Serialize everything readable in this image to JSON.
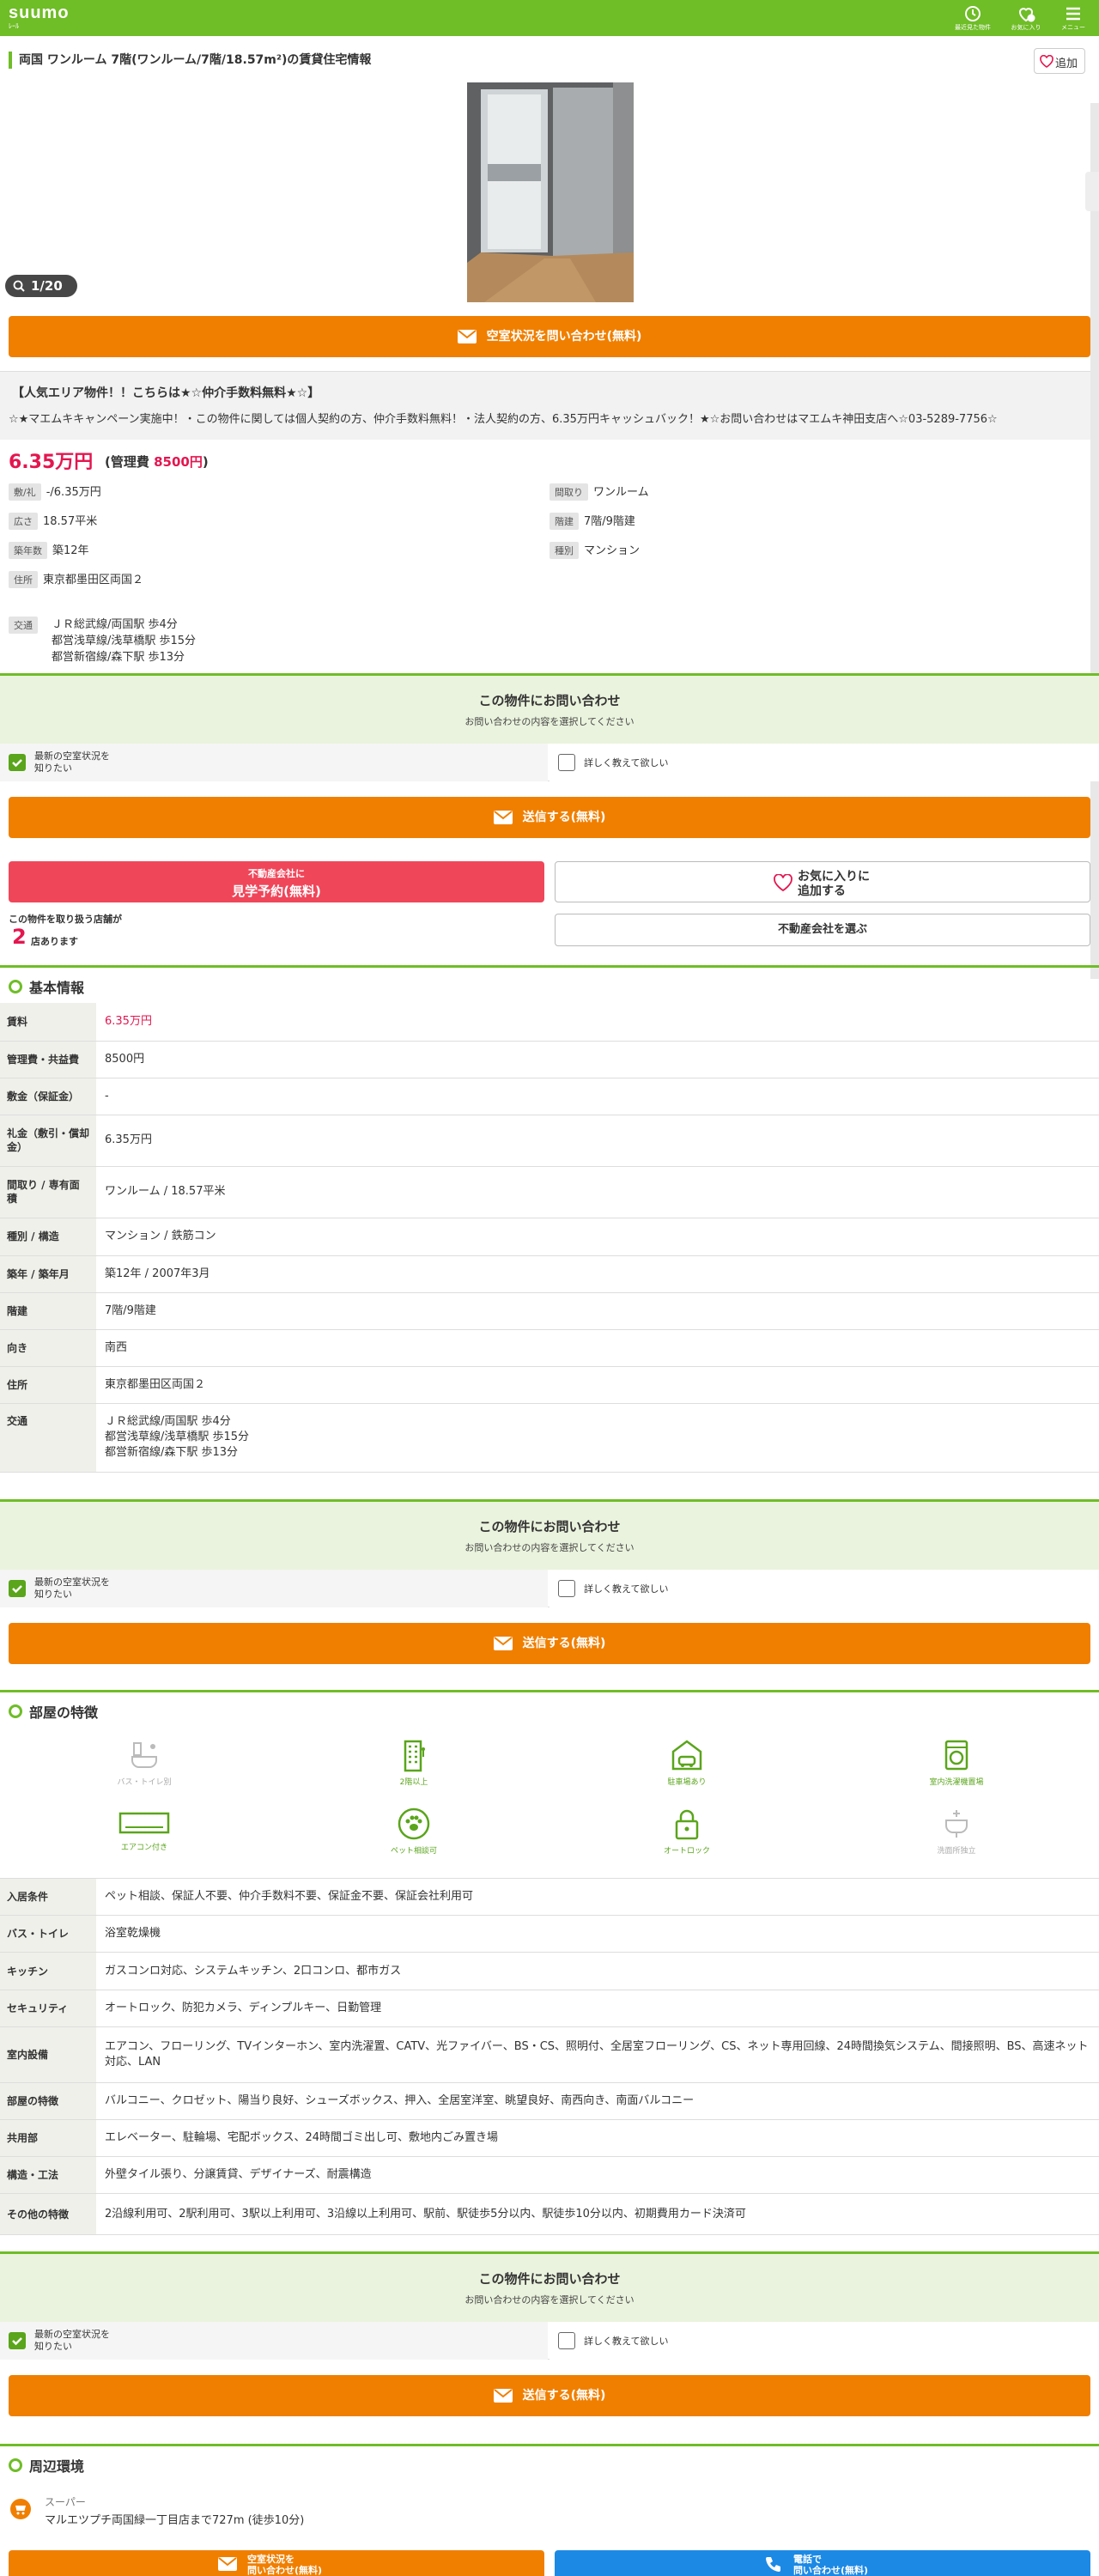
{
  "header": {
    "logo": "suumo",
    "logo_sub": "ﾚｰﾙ",
    "history_label": "最近見た物件",
    "favorites_label": "お気に入り",
    "favorites_count": "0",
    "menu_label": "メニュー"
  },
  "property": {
    "title": "両国 ワンルーム 7階(ワンルーム/7階/18.57m²)の賃貸住宅情報",
    "add_favorite": "追加",
    "photo_counter": "1/20",
    "inquiry_vacancy_button": "空室状況を問い合わせ(無料)",
    "pr_title": "【人気エリア物件！！こちらは★☆仲介手数料無料★☆】",
    "pr_body": "☆★マエムキキャンペーン実施中！・この物件に関しては個人契約の方、仲介手数料無料！・法人契約の方、6.35万円キャッシュバック！★☆お問い合わせはマエムキ神田支店へ☆03-5289-7756☆",
    "rent": "6.35万円",
    "management_label": "(管理費 ",
    "management_value": "8500円",
    "management_close": ")",
    "specs": {
      "deposit_tag": "敷/礼",
      "deposit_value": "-/6.35万円",
      "area_tag": "広さ",
      "area_value": "18.57平米",
      "age_tag": "築年数",
      "age_value": "築12年",
      "address_tag": "住所",
      "address_value": "東京都墨田区両国２",
      "layout_tag": "間取り",
      "layout_value": "ワンルーム",
      "floor_tag": "階建",
      "floor_value": "7階/9階建",
      "type_tag": "種別",
      "type_value": "マンション",
      "access_tag": "交通",
      "access_lines": [
        "ＪＲ総武線/両国駅 歩4分",
        "都営浅草線/浅草橋駅 歩15分",
        "都営新宿線/森下駅 歩13分"
      ]
    }
  },
  "inquiry": {
    "title": "この物件にお問い合わせ",
    "subtitle": "お問い合わせの内容を選択してください",
    "option_a_line1": "最新の空室状況を",
    "option_a_line2": "知りたい",
    "option_b": "詳しく教えて欲しい",
    "send_button": "送信する(無料)"
  },
  "actions": {
    "visit_small": "不動産会社に",
    "visit_large": "見学予約(無料)",
    "favorite_line1": "お気に入りに",
    "favorite_line2": "追加する",
    "shops_text": "この物件を取り扱う店舗が",
    "shops_count": "2",
    "shops_suffix": "店あります",
    "select_agent": "不動産会社を選ぶ"
  },
  "basic_info": {
    "title": "基本情報",
    "rows": [
      {
        "label": "賃料",
        "value": "6.35万円"
      },
      {
        "label": "管理費・共益費",
        "value": "8500円"
      },
      {
        "label": "敷金（保証金）",
        "value": "-"
      },
      {
        "label": "礼金（敷引・償却金）",
        "value": "6.35万円"
      },
      {
        "label": "間取り / 専有面積",
        "value": "ワンルーム / 18.57平米"
      },
      {
        "label": "種別 / 構造",
        "value": "マンション / 鉄筋コン"
      },
      {
        "label": "築年 / 築年月",
        "value": "築12年 / 2007年3月"
      },
      {
        "label": "階建",
        "value": "7階/9階建"
      },
      {
        "label": "向き",
        "value": "南西"
      },
      {
        "label": "住所",
        "value": "東京都墨田区両国２"
      },
      {
        "label": "交通",
        "lines": [
          "ＪＲ総武線/両国駅 歩4分",
          "都営浅草線/浅草橋駅 歩15分",
          "都営新宿線/森下駅 歩13分"
        ]
      }
    ]
  },
  "features": {
    "title": "部屋の特徴",
    "icons": [
      {
        "label": "バス・トイレ別",
        "active": false,
        "icon": "bath-toilet-icon"
      },
      {
        "label": "2階以上",
        "active": true,
        "icon": "building-icon"
      },
      {
        "label": "駐車場あり",
        "active": true,
        "icon": "parking-icon"
      },
      {
        "label": "室内洗濯機置場",
        "active": true,
        "icon": "washer-icon"
      },
      {
        "label": "エアコン付き",
        "active": true,
        "icon": "aircon-icon"
      },
      {
        "label": "ペット相談可",
        "active": true,
        "icon": "pet-icon"
      },
      {
        "label": "オートロック",
        "active": true,
        "icon": "lock-icon"
      },
      {
        "label": "洗面所独立",
        "active": false,
        "icon": "sink-icon"
      }
    ],
    "rows": [
      {
        "label": "入居条件",
        "value": "ペット相談、保証人不要、仲介手数料不要、保証金不要、保証会社利用可"
      },
      {
        "label": "バス・トイレ",
        "value": "浴室乾燥機"
      },
      {
        "label": "キッチン",
        "value": "ガスコンロ対応、システムキッチン、2口コンロ、都市ガス"
      },
      {
        "label": "セキュリティ",
        "value": "オートロック、防犯カメラ、ディンプルキー、日勤管理"
      },
      {
        "label": "室内設備",
        "value": "エアコン、フローリング、TVインターホン、室内洗濯置、CATV、光ファイバー、BS・CS、照明付、全居室フローリング、CS、ネット専用回線、24時間換気システム、間接照明、BS、高速ネット対応、LAN"
      },
      {
        "label": "部屋の特徴",
        "value": "バルコニー、クロゼット、陽当り良好、シューズボックス、押入、全居室洋室、眺望良好、南西向き、南面バルコニー"
      },
      {
        "label": "共用部",
        "value": "エレベーター、駐輪場、宅配ボックス、24時間ゴミ出し可、敷地内ごみ置き場"
      },
      {
        "label": "構造・工法",
        "value": "外壁タイル張り、分譲賃貸、デザイナーズ、耐震構造"
      },
      {
        "label": "その他の特徴",
        "value": "2沿線利用可、2駅利用可、3駅以上利用可、3沿線以上利用可、駅前、駅徒歩5分以内、駅徒歩10分以内、初期費用カード決済可"
      }
    ]
  },
  "nearby": {
    "title": "周辺環境",
    "category": "スーパー",
    "value": "マルエツプチ両国緑一丁目店まで727m (徒歩10分)"
  },
  "bottom_bar": {
    "left_line1": "空室状況を",
    "left_line2": "問い合わせ(無料)",
    "right_line1": "電話で",
    "right_line2": "問い合わせ(無料)"
  },
  "colors": {
    "brand": "#6fbd27",
    "accent": "#f07f00",
    "price": "#e4164f",
    "visit": "#f0465a",
    "phone": "#1c89e5"
  }
}
